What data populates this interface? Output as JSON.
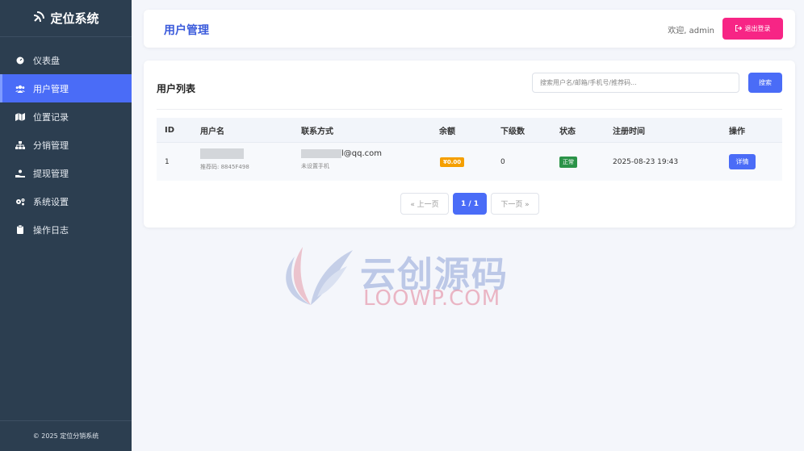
{
  "sidebar": {
    "brand": "定位系统",
    "brand_icon": "satellite-dish-icon",
    "items": [
      {
        "label": "仪表盘",
        "icon": "dashboard-icon",
        "active": false
      },
      {
        "label": "用户管理",
        "icon": "users-icon",
        "active": true
      },
      {
        "label": "位置记录",
        "icon": "map-icon",
        "active": false
      },
      {
        "label": "分销管理",
        "icon": "sitemap-icon",
        "active": false
      },
      {
        "label": "提现管理",
        "icon": "hand-coin-icon",
        "active": false
      },
      {
        "label": "系统设置",
        "icon": "gears-icon",
        "active": false
      },
      {
        "label": "操作日志",
        "icon": "clipboard-icon",
        "active": false
      }
    ],
    "footer": "© 2025 定位分销系统"
  },
  "header": {
    "title": "用户管理",
    "welcome": "欢迎, admin",
    "logout_label": "退出登录"
  },
  "main": {
    "list_title": "用户列表",
    "search_placeholder": "搜索用户名/邮箱/手机号/推荐码...",
    "search_button": "搜索",
    "columns": [
      "ID",
      "用户名",
      "联系方式",
      "余额",
      "下级数",
      "状态",
      "注册时间",
      "操作"
    ],
    "rows": [
      {
        "id": "1",
        "username_sub": "推荐码: 8845F498",
        "email_suffix": "l@qq.com",
        "phone": "未设置手机",
        "balance": "¥0.00",
        "downline": "0",
        "status": "正常",
        "reg_time": "2025-08-23 19:43",
        "action": "详情"
      }
    ],
    "pager": {
      "prev": "« 上一页",
      "current": "1 / 1",
      "next": "下一页 »"
    }
  },
  "watermark": {
    "text_cn": "云创源码",
    "text_en": "LOOWP.COM"
  },
  "colors": {
    "accent": "#4a6cf7",
    "logout": "#f72585",
    "sidebar": "#2c3e50",
    "balance": "#f59f00",
    "status_ok": "#2b9348"
  }
}
